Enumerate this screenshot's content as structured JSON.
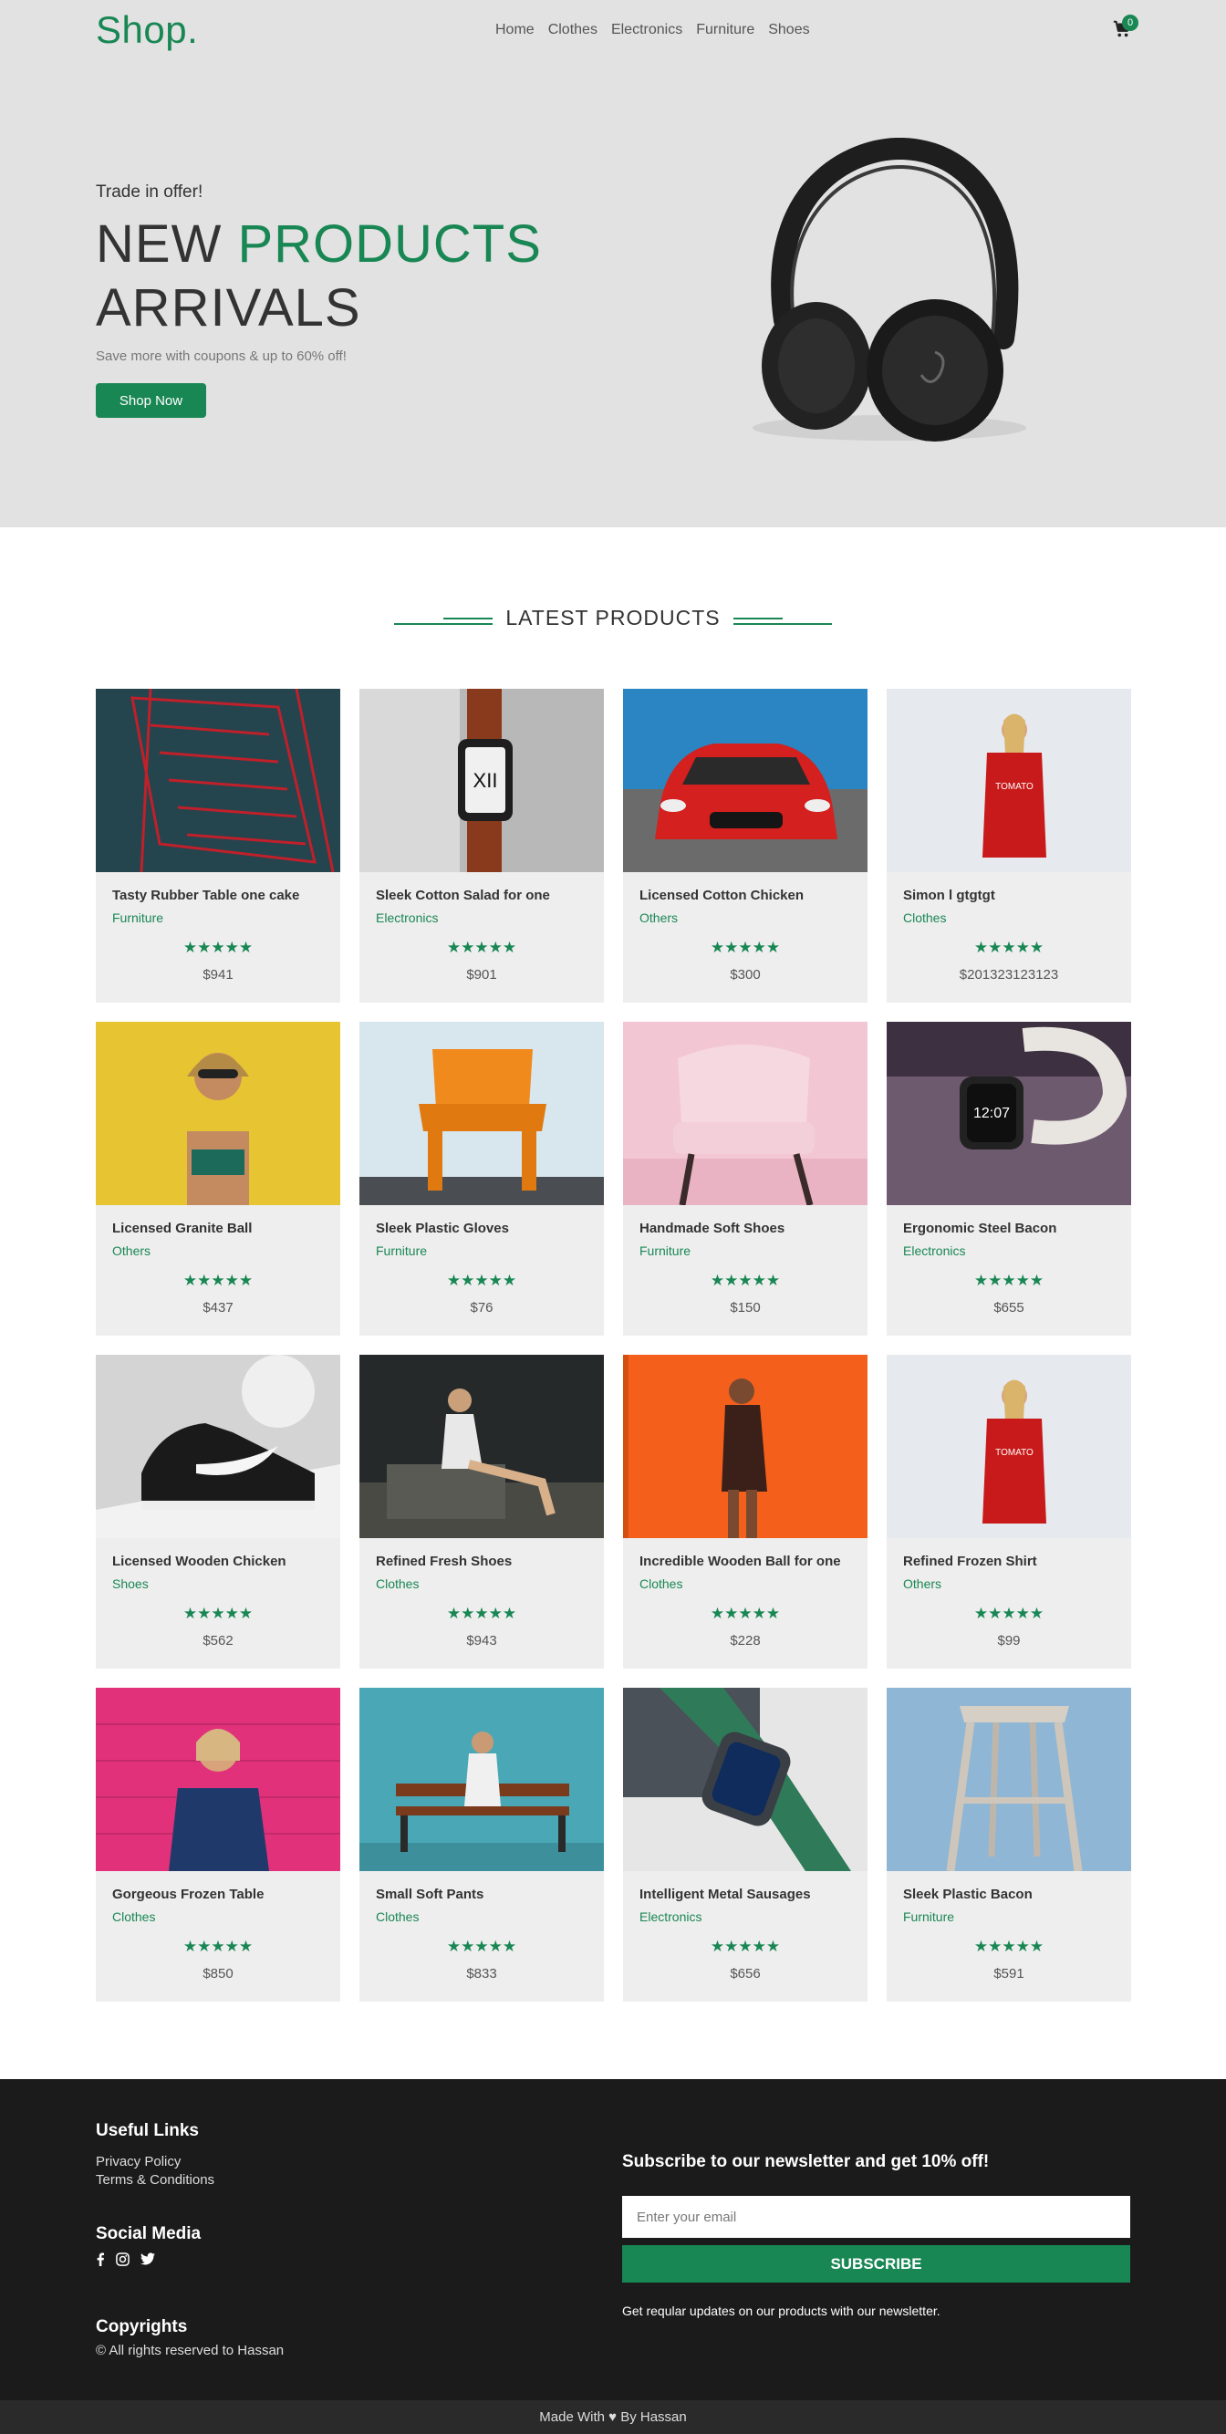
{
  "navbar": {
    "brand": "Shop.",
    "links": [
      "Home",
      "Clothes",
      "Electronics",
      "Furniture",
      "Shoes"
    ],
    "cart_count": "0"
  },
  "hero": {
    "pretitle": "Trade in offer!",
    "title_part1": "NEW ",
    "title_accent": "PRODUCTS",
    "title_part2": "ARRIVALS",
    "subtitle": "Save more with coupons & up to 60% off!",
    "button": "Shop Now"
  },
  "section": {
    "title": "LATEST PRODUCTS"
  },
  "products": [
    {
      "name": "Tasty Rubber Table one cake",
      "category": "Furniture",
      "price": "$941",
      "stars": "★★★★★",
      "rating": 4.5,
      "image": "red-wire-chair"
    },
    {
      "name": "Sleek Cotton Salad for one",
      "category": "Electronics",
      "price": "$901",
      "stars": "★★★★★",
      "rating": 4.5,
      "image": "smartwatch-orange-band"
    },
    {
      "name": "Licensed Cotton Chicken",
      "category": "Others",
      "price": "$300",
      "stars": "★★★★★",
      "rating": 4.5,
      "image": "red-car"
    },
    {
      "name": "Simon l gtgtgt",
      "category": "Clothes",
      "price": "$201323123123",
      "stars": "★★★★★",
      "rating": 4.5,
      "image": "woman-red-sweater"
    },
    {
      "name": "Licensed Granite Ball",
      "category": "Others",
      "price": "$437",
      "stars": "★★★★★",
      "rating": 4.5,
      "image": "woman-yellow-wall"
    },
    {
      "name": "Sleek Plastic Gloves",
      "category": "Furniture",
      "price": "$76",
      "stars": "★★★★★",
      "rating": 4.5,
      "image": "orange-chair"
    },
    {
      "name": "Handmade Soft Shoes",
      "category": "Furniture",
      "price": "$150",
      "stars": "★★★★★",
      "rating": 4.5,
      "image": "pink-armchair"
    },
    {
      "name": "Ergonomic Steel Bacon",
      "category": "Electronics",
      "price": "$655",
      "stars": "★★★★★",
      "rating": 4.5,
      "image": "white-smartwatch"
    },
    {
      "name": "Licensed Wooden Chicken",
      "category": "Shoes",
      "price": "$562",
      "stars": "★★★★★",
      "rating": 4.5,
      "image": "black-sneaker"
    },
    {
      "name": "Refined Fresh Shoes",
      "category": "Clothes",
      "price": "$943",
      "stars": "★★★★★",
      "rating": 4.5,
      "image": "woman-sitting-rocks"
    },
    {
      "name": "Incredible Wooden Ball for one",
      "category": "Clothes",
      "price": "$228",
      "stars": "★★★★★",
      "rating": 4.5,
      "image": "woman-orange-wall"
    },
    {
      "name": "Refined Frozen Shirt",
      "category": "Others",
      "price": "$99",
      "stars": "★★★★★",
      "rating": 4.5,
      "image": "woman-red-sweater"
    },
    {
      "name": "Gorgeous Frozen Table",
      "category": "Clothes",
      "price": "$850",
      "stars": "★★★★★",
      "rating": 4.5,
      "image": "woman-pink-wall"
    },
    {
      "name": "Small Soft Pants",
      "category": "Clothes",
      "price": "$833",
      "stars": "★★★★★",
      "rating": 4.5,
      "image": "man-bench-blue"
    },
    {
      "name": "Intelligent Metal Sausages",
      "category": "Electronics",
      "price": "$656",
      "stars": "★★★★★",
      "rating": 4.5,
      "image": "green-smartwatch"
    },
    {
      "name": "Sleek Plastic Bacon",
      "category": "Furniture",
      "price": "$591",
      "stars": "★★★★★",
      "rating": 4.5,
      "image": "wooden-stool"
    }
  ],
  "footer": {
    "useful_links_title": "Useful Links",
    "links": [
      "Privacy Policy",
      "Terms & Conditions"
    ],
    "social_title": "Social Media",
    "social_icons": [
      "facebook-icon",
      "instagram-icon",
      "twitter-icon"
    ],
    "copyright_title": "Copyrights",
    "copyright_text": "© All rights reserved to Hassan",
    "newsletter_title": "Subscribe to our newsletter and get 10% off!",
    "email_placeholder": "Enter your email",
    "subscribe_button": "SUBSCRIBE",
    "newsletter_note": "Get reqular updates on our products with our newsletter."
  },
  "bottom_bar": "Made With ♥ By Hassan",
  "colors": {
    "accent": "#198754",
    "hero_bg": "#e2e2e2",
    "card_bg": "#eeeeee",
    "footer_bg": "#1b1b1b"
  }
}
